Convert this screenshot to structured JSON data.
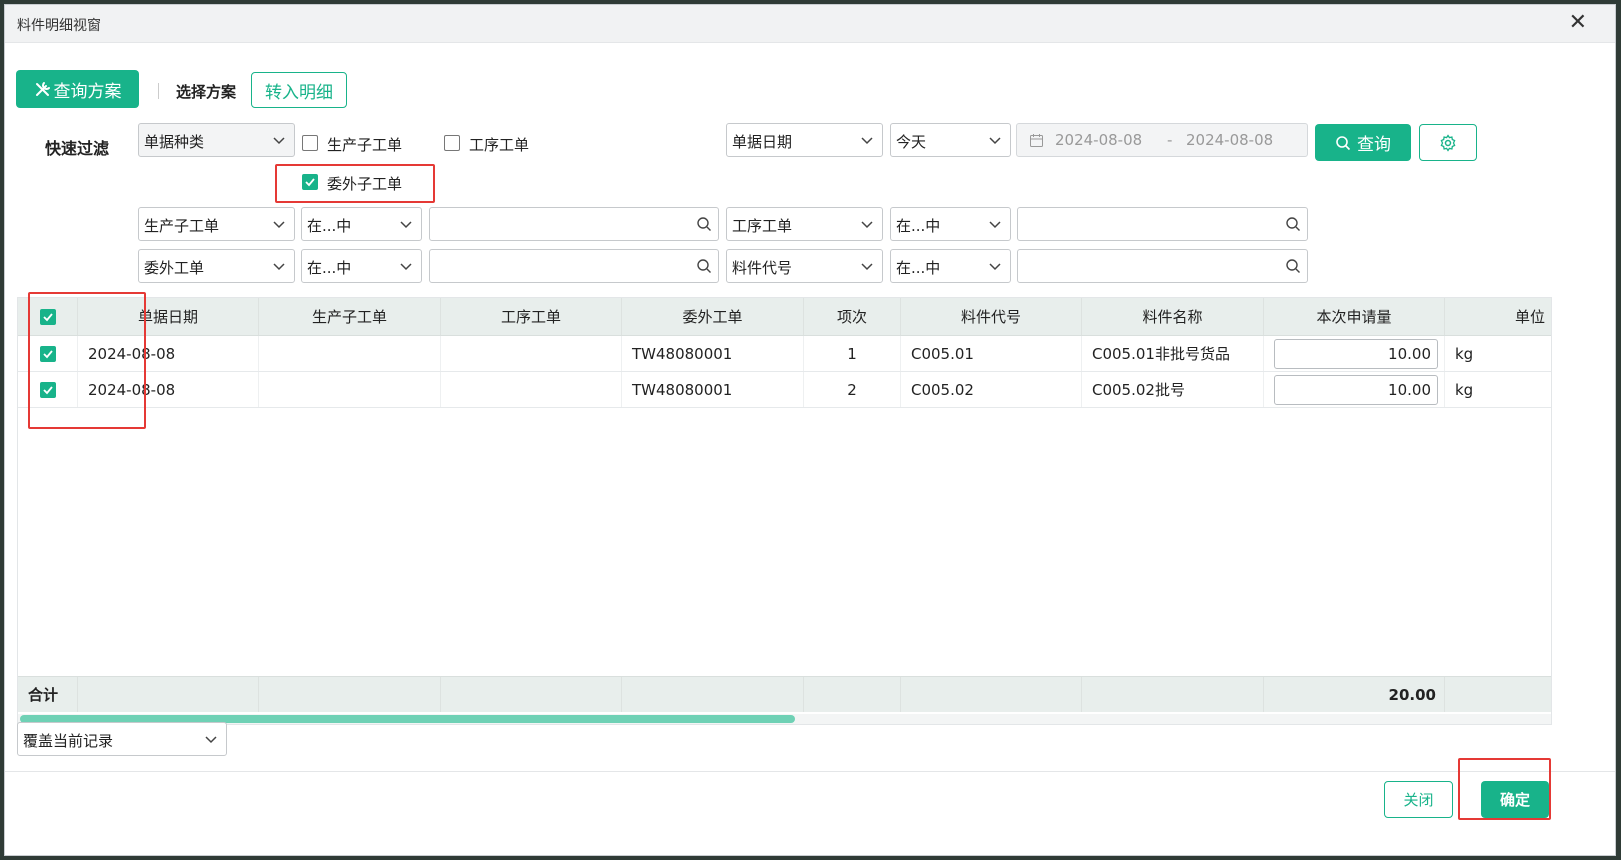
{
  "window": {
    "title": "料件明细视窗"
  },
  "toolbar": {
    "query_scheme_label": "查询方案",
    "select_scheme_label": "选择方案",
    "transfer_detail_label": "转入明细"
  },
  "quick_filter": {
    "label": "快速过滤",
    "doc_type_select": "单据种类",
    "checkboxes": [
      {
        "label": "生产子工单",
        "checked": false
      },
      {
        "label": "工序工单",
        "checked": false
      },
      {
        "label": "委外子工单",
        "checked": true
      }
    ],
    "date_field_select": "单据日期",
    "date_range_select": "今天",
    "date_start": "2024-08-08",
    "date_sep": "-",
    "date_end": "2024-08-08",
    "query_button": "查询"
  },
  "conditions": [
    {
      "field": "生产子工单",
      "op": "在...中",
      "value": ""
    },
    {
      "field": "工序工单",
      "op": "在...中",
      "value": ""
    },
    {
      "field": "委外工单",
      "op": "在...中",
      "value": ""
    },
    {
      "field": "料件代号",
      "op": "在...中",
      "value": ""
    }
  ],
  "table": {
    "columns": [
      "单据日期",
      "生产子工单",
      "工序工单",
      "委外工单",
      "项次",
      "料件代号",
      "料件名称",
      "本次申请量",
      "单位"
    ],
    "rows": [
      {
        "checked": true,
        "date": "2024-08-08",
        "prod_order": "",
        "process_order": "",
        "outsource_order": "TW48080001",
        "seq": "1",
        "item_code": "C005.01",
        "item_name": "C005.01非批号货品",
        "qty": "10.00",
        "unit": "kg"
      },
      {
        "checked": true,
        "date": "2024-08-08",
        "prod_order": "",
        "process_order": "",
        "outsource_order": "TW48080001",
        "seq": "2",
        "item_code": "C005.02",
        "item_name": "C005.02批号",
        "qty": "10.00",
        "unit": "kg"
      }
    ],
    "footer": {
      "label": "合计",
      "qty_total": "20.00"
    }
  },
  "bottom": {
    "mode_select": "覆盖当前记录",
    "close_button": "关闭",
    "confirm_button": "确定"
  },
  "colors": {
    "accent": "#18b38a",
    "highlight": "#e53935"
  }
}
